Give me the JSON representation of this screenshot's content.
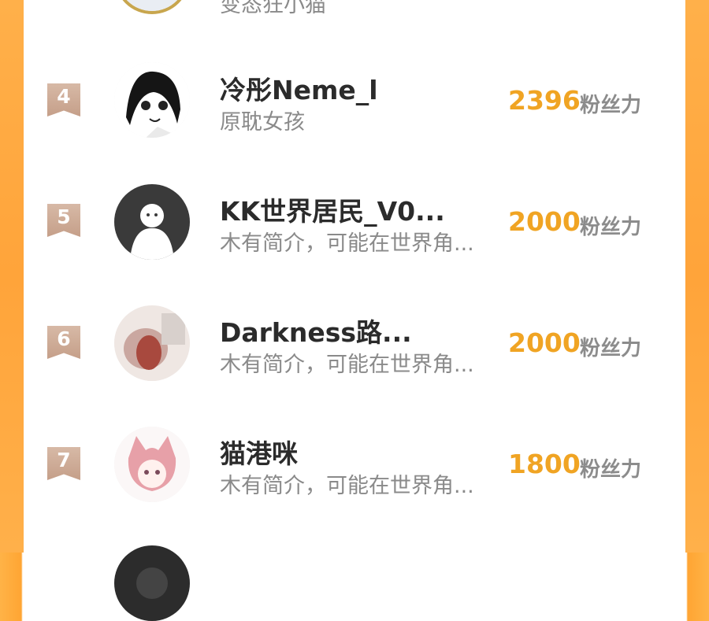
{
  "partial_top": {
    "bio": "变态狂小猫"
  },
  "rows": [
    {
      "rank": "4",
      "name": "冷彤Neme_l",
      "bio": "原耽女孩",
      "score": "2396",
      "unit": "粉丝力"
    },
    {
      "rank": "5",
      "name": "KK世界居民_V0...",
      "bio": "木有简介，可能在世界角...",
      "score": "2000",
      "unit": "粉丝力"
    },
    {
      "rank": "6",
      "name": "Darkness路...",
      "bio": "木有简介，可能在世界角...",
      "score": "2000",
      "unit": "粉丝力"
    },
    {
      "rank": "7",
      "name": "猫港咪",
      "bio": "木有简介，可能在世界角...",
      "score": "1800",
      "unit": "粉丝力"
    }
  ],
  "colors": {
    "accent": "#f0a423",
    "frame": "#ffa43a",
    "badge": "#c9a58e"
  }
}
